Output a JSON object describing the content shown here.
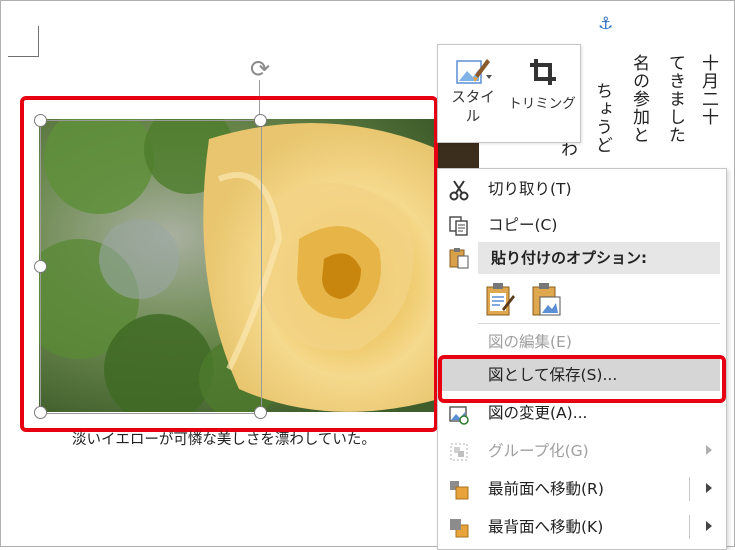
{
  "document": {
    "vertical_columns": [
      "十月二十",
      "てきました",
      "名の参加と",
      "ちょうど",
      "わ"
    ],
    "caption": "淡いイエローが可憐な美しさを漂わしていた。"
  },
  "mini_toolbar": {
    "style_label_1": "スタイ",
    "style_label_2": "ル",
    "crop_label": "トリミング"
  },
  "context_menu": {
    "cut": "切り取り(T)",
    "copy": "コピー(C)",
    "paste_options_header": "貼り付けのオプション:",
    "edit_picture": "図の編集(E)",
    "save_as_picture": "図として保存(S)...",
    "change_picture": "図の変更(A)...",
    "group": "グループ化(G)",
    "bring_to_front": "最前面へ移動(R)",
    "send_to_back": "最背面へ移動(K)"
  },
  "icons": {
    "cut": "scissors-icon",
    "copy": "copy-icon",
    "paste": "clipboard-icon",
    "change_picture": "change-picture-icon",
    "group": "group-icon",
    "bring_to_front": "bring-to-front-icon",
    "send_to_back": "send-to-back-icon",
    "anchor": "anchor-icon",
    "rotate": "rotate-icon"
  },
  "colors": {
    "highlight_red": "#e60012",
    "menu_highlight": "#d6d6d6",
    "disabled_text": "#a0a0a0"
  }
}
